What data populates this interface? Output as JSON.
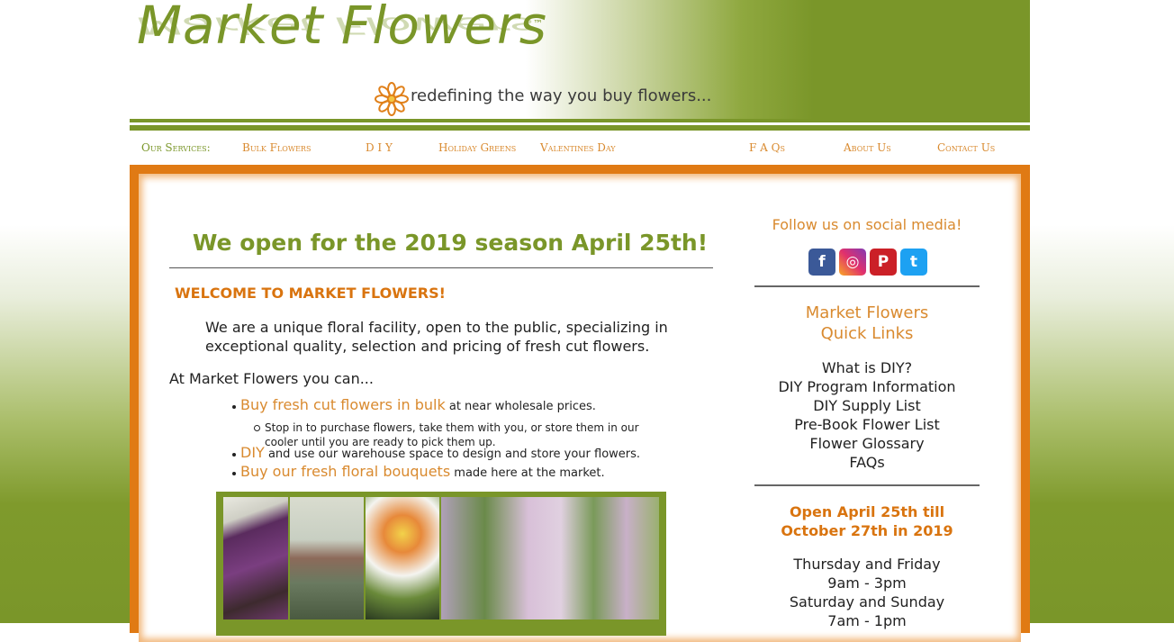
{
  "header": {
    "logo_text": "Market Flowers",
    "logo_tm": "™",
    "tagline": "redefining the way you buy flowers..."
  },
  "nav": {
    "label": "Our Services:",
    "items": [
      "Bulk Flowers",
      "D I Y",
      "Holiday Greens",
      "Valentines Day",
      "F A Qs",
      "About Us",
      "Contact Us"
    ]
  },
  "main": {
    "heading": "We open for the 2019 season April 25th!",
    "welcome": "WELCOME TO MARKET FLOWERS!",
    "intro": "We are a unique floral facility, open to the public, specializing in exceptional quality, selection and pricing of fresh cut flowers.",
    "can_do": "At Market Flowers you can...",
    "bullets": [
      {
        "link": "Buy fresh cut flowers in bulk",
        "text": " at near wholesale prices."
      },
      {
        "link": "DIY",
        "text": " and use our warehouse space to design and store your flowers."
      },
      {
        "link": "Buy our fresh floral bouquets",
        "text": " made here at the market."
      }
    ],
    "sub_bullet": "Stop in to purchase flowers, take them with you, or store them in our cooler until you are ready to pick them up."
  },
  "sidebar": {
    "follow": "Follow us on social media!",
    "social": [
      {
        "name": "facebook",
        "glyph": "f",
        "color": "#3b5998"
      },
      {
        "name": "instagram",
        "glyph": "◎",
        "color": "#c13584"
      },
      {
        "name": "pinterest",
        "glyph": "P",
        "color": "#cb2027"
      },
      {
        "name": "twitter",
        "glyph": "t",
        "color": "#1da1f2"
      }
    ],
    "quick_links_title_1": "Market Flowers",
    "quick_links_title_2": "Quick Links",
    "quick_links": [
      "What is DIY?",
      "DIY Program Information",
      "DIY Supply List",
      "Pre-Book Flower List",
      "Flower Glossary",
      "FAQs"
    ],
    "open_title_1": "Open April 25th till",
    "open_title_2": "October 27th in 2019",
    "hours": [
      "Thursday and Friday",
      "9am - 3pm",
      "Saturday and Sunday",
      "7am - 1pm"
    ]
  },
  "colors": {
    "green": "#7a9629",
    "orange": "#d98a2f"
  }
}
